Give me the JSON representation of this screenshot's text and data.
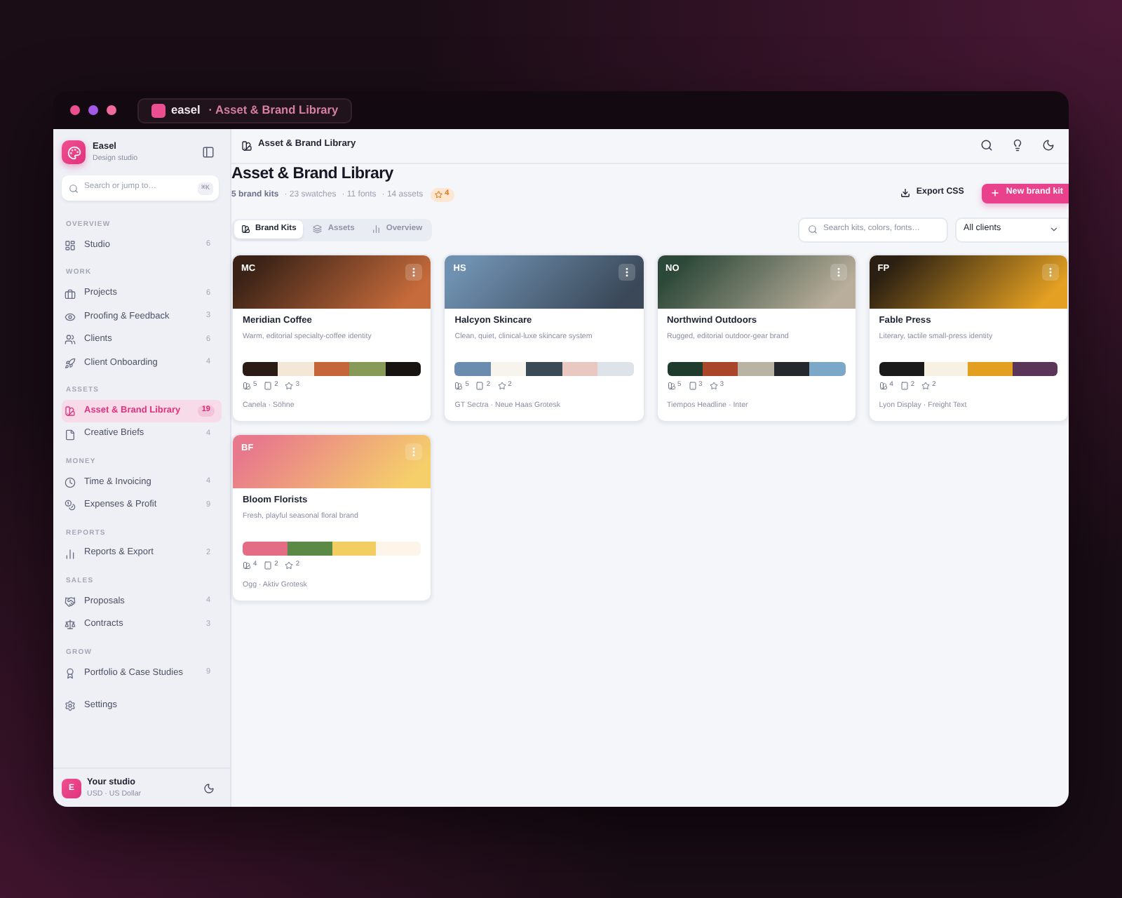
{
  "window": {
    "app_name": "easel",
    "title": "· Asset & Brand Library"
  },
  "sidebar": {
    "brand": {
      "name": "Easel",
      "subtitle": "Design studio"
    },
    "search": {
      "placeholder": "Search or jump to…",
      "shortcut": "⌘K"
    },
    "sections": [
      {
        "label": "OVERVIEW",
        "items": [
          {
            "label": "Studio",
            "count": "6",
            "selected": false
          }
        ]
      },
      {
        "label": "WORK",
        "items": [
          {
            "label": "Projects",
            "count": "6",
            "selected": false
          },
          {
            "label": "Proofing & Feedback",
            "count": "3",
            "selected": false
          },
          {
            "label": "Clients",
            "count": "6",
            "selected": false
          },
          {
            "label": "Client Onboarding",
            "count": "4",
            "selected": false
          }
        ]
      },
      {
        "label": "ASSETS",
        "items": [
          {
            "label": "Asset & Brand Library",
            "count": "19",
            "selected": true
          },
          {
            "label": "Creative Briefs",
            "count": "4",
            "selected": false
          }
        ]
      },
      {
        "label": "MONEY",
        "items": [
          {
            "label": "Time & Invoicing",
            "count": "4",
            "selected": false
          },
          {
            "label": "Expenses & Profit",
            "count": "9",
            "selected": false
          }
        ]
      },
      {
        "label": "REPORTS",
        "items": [
          {
            "label": "Reports & Export",
            "count": "2",
            "selected": false
          }
        ]
      },
      {
        "label": "SALES",
        "items": [
          {
            "label": "Proposals",
            "count": "4",
            "selected": false
          },
          {
            "label": "Contracts",
            "count": "3",
            "selected": false
          }
        ]
      },
      {
        "label": "GROW",
        "items": [
          {
            "label": "Portfolio & Case Studies",
            "count": "9",
            "selected": false
          }
        ]
      }
    ],
    "settings": {
      "label": "Settings",
      "selected": false
    },
    "footer": {
      "avatar": "E",
      "name": "Your studio",
      "currency": "USD · US Dollar"
    }
  },
  "header": {
    "breadcrumb": "Asset & Brand Library"
  },
  "page": {
    "title": "Asset & Brand Library",
    "summary": [
      "5 brand kits",
      "· 23 swatches",
      "· 11 fonts",
      "· 14 assets"
    ],
    "badge": "4",
    "actions": [
      {
        "label": "Export CSS",
        "kind": "secondary"
      },
      {
        "label": "New brand kit",
        "kind": "primary"
      }
    ]
  },
  "tabs": [
    {
      "label": "Brand Kits",
      "selected": true
    },
    {
      "label": "Assets",
      "selected": false
    },
    {
      "label": "Overview",
      "selected": false
    }
  ],
  "filters": {
    "search": {
      "placeholder": "Search kits, colors, fonts…"
    },
    "client_select": {
      "value": "All clients"
    }
  },
  "brand_kits": [
    {
      "initials": "MC",
      "name": "Meridian Coffee",
      "description": "Warm, editorial specialty-coffee identity",
      "cover": [
        {
          "color": "#3a2216"
        },
        {
          "color": "#c66b3b"
        }
      ],
      "palette": [
        {
          "color": "#2a1c14"
        },
        {
          "color": "#f3e8d8"
        },
        {
          "color": "#c4663a"
        },
        {
          "color": "#879a58"
        },
        {
          "color": "#171310"
        }
      ],
      "stats": [
        "5",
        "2",
        "3"
      ],
      "fonts": "Canela · Söhne"
    },
    {
      "initials": "HS",
      "name": "Halcyon Skincare",
      "description": "Clean, quiet, clinical-luxe skincare system",
      "cover": [
        {
          "color": "#6f90b0"
        },
        {
          "color": "#3a4858"
        }
      ],
      "palette": [
        {
          "color": "#6a8caf"
        },
        {
          "color": "#f7f4ee"
        },
        {
          "color": "#3a4a57"
        },
        {
          "color": "#e8c8c0"
        },
        {
          "color": "#dde3e8"
        }
      ],
      "stats": [
        "5",
        "2",
        "2"
      ],
      "fonts": "GT Sectra · Neue Haas Grotesk"
    },
    {
      "initials": "NO",
      "name": "Northwind Outdoors",
      "description": "Rugged, editorial outdoor-gear brand",
      "cover": [
        {
          "color": "#2c4838"
        },
        {
          "color": "#b9ae9b"
        }
      ],
      "palette": [
        {
          "color": "#1f3b2d"
        },
        {
          "color": "#a9452a"
        },
        {
          "color": "#b9b3a3"
        },
        {
          "color": "#25292e"
        },
        {
          "color": "#7ba7c9"
        }
      ],
      "stats": [
        "5",
        "3",
        "3"
      ],
      "fonts": "Tiempos Headline · Inter"
    },
    {
      "initials": "FP",
      "name": "Fable Press",
      "description": "Literary, tactile small-press identity",
      "cover": [
        {
          "color": "#2a1f12"
        },
        {
          "color": "#e3a022"
        }
      ],
      "palette": [
        {
          "color": "#1a1a1a"
        },
        {
          "color": "#f7f1e3"
        },
        {
          "color": "#e3a020"
        },
        {
          "color": "#5a3558"
        }
      ],
      "stats": [
        "4",
        "2",
        "2"
      ],
      "fonts": "Lyon Display · Freight Text"
    },
    {
      "initials": "BF",
      "name": "Bloom Florists",
      "description": "Fresh, playful seasonal floral brand",
      "cover": [
        {
          "color": "#e8798c"
        },
        {
          "color": "#f5cf6a"
        }
      ],
      "palette": [
        {
          "color": "#e36d85"
        },
        {
          "color": "#5a8a45"
        },
        {
          "color": "#f2cd62"
        },
        {
          "color": "#fdf5ea"
        }
      ],
      "stats": [
        "4",
        "2",
        "2"
      ],
      "fonts": "Ogg · Aktiv Grotesk"
    }
  ]
}
